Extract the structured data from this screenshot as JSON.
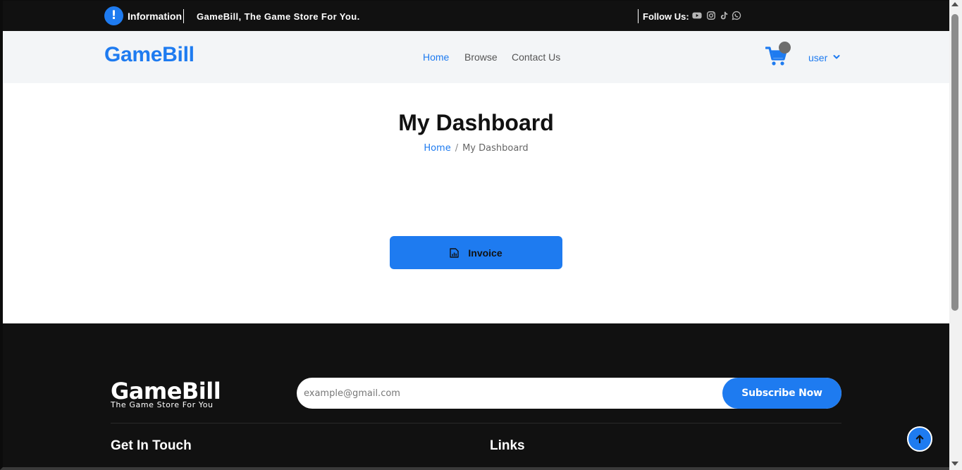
{
  "topbar": {
    "info_icon_glyph": "!",
    "info_label": "Information",
    "info_text": "GameBill, The Game Store For You.",
    "follow_label": "Follow Us:",
    "socials": [
      "youtube-icon",
      "instagram-icon",
      "tiktok-icon",
      "whatsapp-icon"
    ]
  },
  "navbar": {
    "brand": "GameBill",
    "links": [
      {
        "label": "Home",
        "active": true
      },
      {
        "label": "Browse",
        "active": false
      },
      {
        "label": "Contact Us",
        "active": false
      }
    ],
    "user_label": "user"
  },
  "main": {
    "title": "My Dashboard",
    "breadcrumb": {
      "home": "Home",
      "separator": "/",
      "current": "My Dashboard"
    },
    "invoice_button": "Invoice"
  },
  "footer": {
    "brand": "GameBill",
    "tagline": "The Game Store For You",
    "email_placeholder": "example@gmail.com",
    "subscribe_button": "Subscribe Now",
    "headings": [
      "Get In Touch",
      "Links"
    ]
  },
  "colors": {
    "accent": "#1e7bf0",
    "topbar_bg": "#111111",
    "navbar_bg": "#f3f5f7",
    "footer_bg": "#111111"
  }
}
